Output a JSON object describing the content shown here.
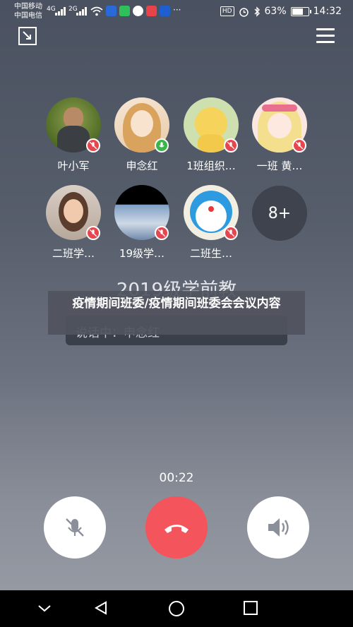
{
  "status_bar": {
    "carrier_1": "中国移动",
    "carrier_2": "中国电信",
    "signal_1": "4G",
    "signal_2": "2G",
    "hd": "HD",
    "battery_percent": "63%",
    "battery_level": 0.63,
    "time": "14:32",
    "more_dots": "···"
  },
  "members": [
    {
      "name": "叶小军",
      "mic": "muted"
    },
    {
      "name": "申念红",
      "mic": "on"
    },
    {
      "name": "1班组织…",
      "mic": "muted"
    },
    {
      "name": "一班 黄…",
      "mic": "muted"
    },
    {
      "name": "二班学…",
      "mic": "muted"
    },
    {
      "name": "19级学…",
      "mic": "muted"
    },
    {
      "name": "二班生…",
      "mic": "muted"
    }
  ],
  "more_count": "8+",
  "group_title": "2019级学前教",
  "speaking_label": "说话中：申念红",
  "overlay_text": "疫情期间班委/疫情期间班委会会议内容",
  "timer": "00:22",
  "colors": {
    "hangup": "#f4545c",
    "mic_muted": "#e6474f",
    "mic_on": "#39b54a"
  }
}
